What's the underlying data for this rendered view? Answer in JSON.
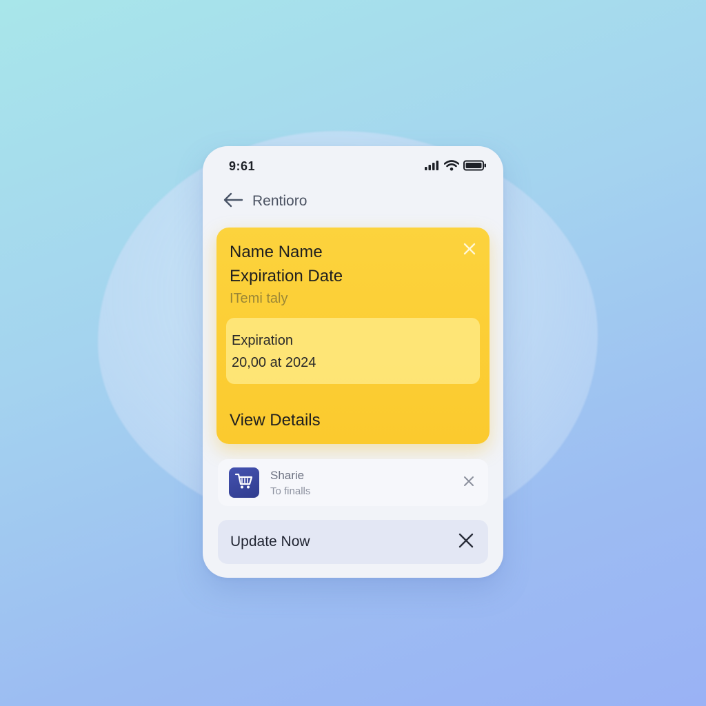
{
  "status_bar": {
    "time": "9:61",
    "icons": [
      "signal-icon",
      "wifi-icon",
      "battery-icon"
    ]
  },
  "nav": {
    "back_icon": "arrow-left-icon",
    "title": "Rentioro"
  },
  "yellow_card": {
    "title": "Name Name",
    "subtitle": "Expiration Date",
    "meta": "ITemi taly",
    "close_icon": "close-icon",
    "detail_label": "Expiration",
    "detail_value": "20,00 at 2024",
    "action_label": "View Details",
    "color": "#fcd33d"
  },
  "notification": {
    "icon": "shopping-cart-icon",
    "title": "Sharie",
    "subtitle": "To finalls",
    "close_icon": "close-icon",
    "icon_color": "#3a47a0"
  },
  "update_bar": {
    "label": "Update Now",
    "close_icon": "close-icon"
  }
}
